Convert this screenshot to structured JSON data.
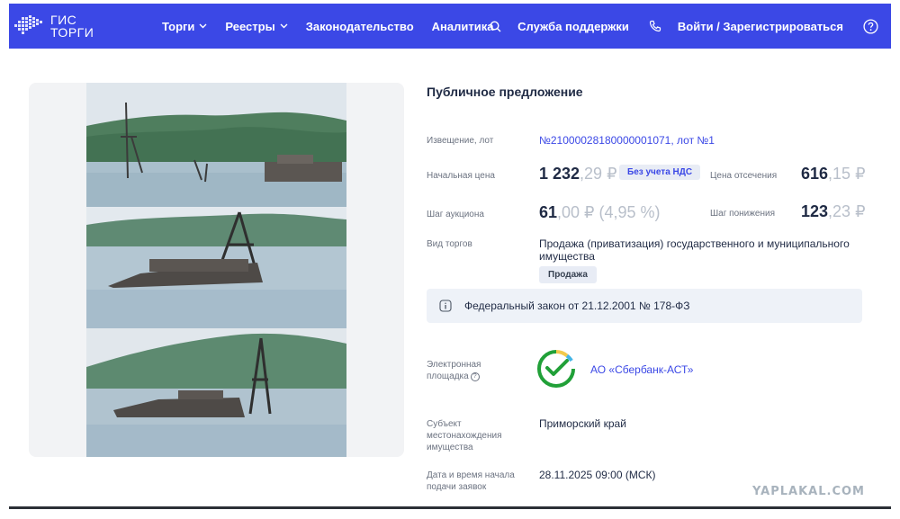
{
  "header": {
    "logo_line1": "ГИС",
    "logo_line2": "ТОРГИ",
    "nav": [
      {
        "label": "Торги",
        "has_dropdown": true
      },
      {
        "label": "Реестры",
        "has_dropdown": true
      },
      {
        "label": "Законодательство",
        "has_dropdown": false
      },
      {
        "label": "Аналитика",
        "has_dropdown": false
      }
    ],
    "support_label": "Служба поддержки",
    "login_label": "Войти / Зарегистрироваться",
    "icons": [
      "search-icon",
      "phone-icon",
      "help-icon"
    ],
    "bg_color": "#3b48e6"
  },
  "lot": {
    "heading": "Публичное предложение",
    "notice_label": "Извещение, лот",
    "notice_value": "№21000028180000001071, лот №1",
    "start_price_label": "Начальная цена",
    "start_price_int": "1 232",
    "start_price_frac": ",29 ₽",
    "vat_badge": "Без учета НДС",
    "cutoff_price_label": "Цена отсечения",
    "cutoff_price_int": "616",
    "cutoff_price_frac": ",15 ₽",
    "step_label": "Шаг аукциона",
    "step_int": "61",
    "step_frac": ",00 ₽ (4,95 %)",
    "decrease_step_label": "Шаг понижения",
    "decrease_step_int": "123",
    "decrease_step_frac": ",23 ₽",
    "trade_type_label": "Вид торгов",
    "trade_type_line1": "Продажа (приватизация) государственного и муниципального",
    "trade_type_line2": "имущества",
    "trade_chip": "Продажа",
    "law_text": "Федеральный закон от 21.12.2001 № 178-ФЗ",
    "platform_label_line1": "Электронная",
    "platform_label_line2": "площадка",
    "platform_name": "АО «Сбербанк-АСТ»",
    "region_label_line1": "Субъект",
    "region_label_line2": "местонахождения",
    "region_label_line3": "имущества",
    "region_value": "Приморский край",
    "date_label_line1": "Дата и время начала",
    "date_label_line2": "подачи заявок",
    "date_value": "28.11.2025 09:00 (МСК)"
  },
  "watermark": "YAPLAKAL.COM"
}
